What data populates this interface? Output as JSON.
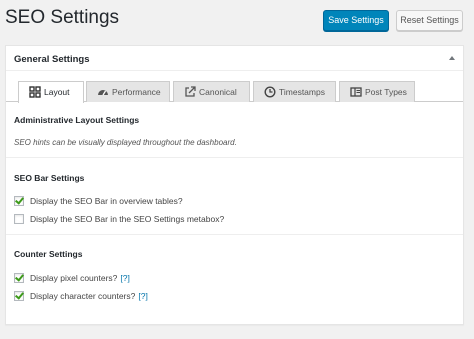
{
  "header": {
    "title": "SEO Settings",
    "save_label": "Save Settings",
    "reset_label": "Reset Settings"
  },
  "panel": {
    "title": "General Settings",
    "toggle_icon": "triangle-up-icon"
  },
  "tabs": [
    {
      "label": "Layout",
      "icon": "grid-icon",
      "active": true
    },
    {
      "label": "Performance",
      "icon": "dashboard-icon",
      "active": false
    },
    {
      "label": "Canonical",
      "icon": "external-link-icon",
      "active": false
    },
    {
      "label": "Timestamps",
      "icon": "clock-icon",
      "active": false
    },
    {
      "label": "Post Types",
      "icon": "layout-icon",
      "active": false
    }
  ],
  "sections": {
    "admin_layout": {
      "title": "Administrative Layout Settings",
      "description": "SEO hints can be visually displayed throughout the dashboard."
    },
    "seo_bar": {
      "title": "SEO Bar Settings",
      "options": [
        {
          "label": "Display the SEO Bar in overview tables?",
          "checked": true
        },
        {
          "label": "Display the SEO Bar in the SEO Settings metabox?",
          "checked": false
        }
      ]
    },
    "counter": {
      "title": "Counter Settings",
      "options": [
        {
          "label": "Display pixel counters?",
          "help": "[?]",
          "checked": true
        },
        {
          "label": "Display character counters?",
          "help": "[?]",
          "checked": true
        }
      ]
    }
  },
  "colors": {
    "primary": "#0085ba",
    "check": "#3d9a1a",
    "background": "#f1f1f1"
  }
}
